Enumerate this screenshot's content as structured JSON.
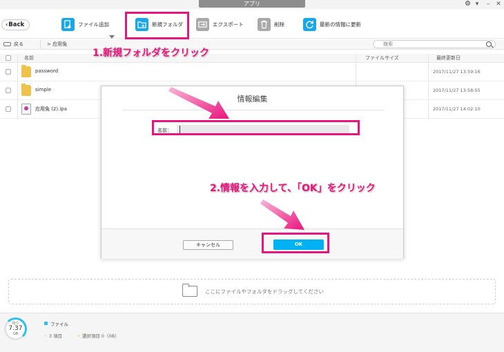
{
  "window": {
    "title": "アプリ",
    "settings_icon": "gear-icon",
    "minimize": "–"
  },
  "toolbar": {
    "back_label": "Back",
    "add_file_label": "ファイル追加",
    "new_folder_label": "新規フォルダ",
    "export_label": "エクスポート",
    "delete_label": "削除",
    "refresh_label": "最新の情報に更新"
  },
  "pathbar": {
    "back_label": "戻る",
    "path": "> 应用兔",
    "search_placeholder": "検索"
  },
  "table": {
    "headers": {
      "name": "名前",
      "size": "ファイルサイズ",
      "date": "最終更新日"
    },
    "rows": [
      {
        "name": "password",
        "type": "folder",
        "date": "2017/11/27 13:59:16"
      },
      {
        "name": "simple",
        "type": "folder",
        "date": "2017/11/27 13:58:55"
      },
      {
        "name": "应用兔 (2).ipa",
        "type": "ipa",
        "date": "2017/11/27 14:02:10"
      }
    ]
  },
  "dialog": {
    "title": "情報編集",
    "name_label": "名前：",
    "name_value": "",
    "cancel_label": "キャンセル",
    "ok_label": "OK"
  },
  "dropzone": {
    "text": "ここにファイルやフォルダをドラッグしてください"
  },
  "status": {
    "ring_label": "残り",
    "storage_value": "7.37",
    "storage_unit": "GB",
    "legend_label": "ファイル",
    "item_count": "3 項目",
    "selected_count": "選択項目 0（0B）"
  },
  "annotations": {
    "step1": "1.新規フォルダをクリック",
    "step2": "2.情報を入力して、「OK」をクリック"
  },
  "colors": {
    "accent": "#00b1f4",
    "highlight": "#e9157e",
    "folder": "#f0c24a"
  }
}
